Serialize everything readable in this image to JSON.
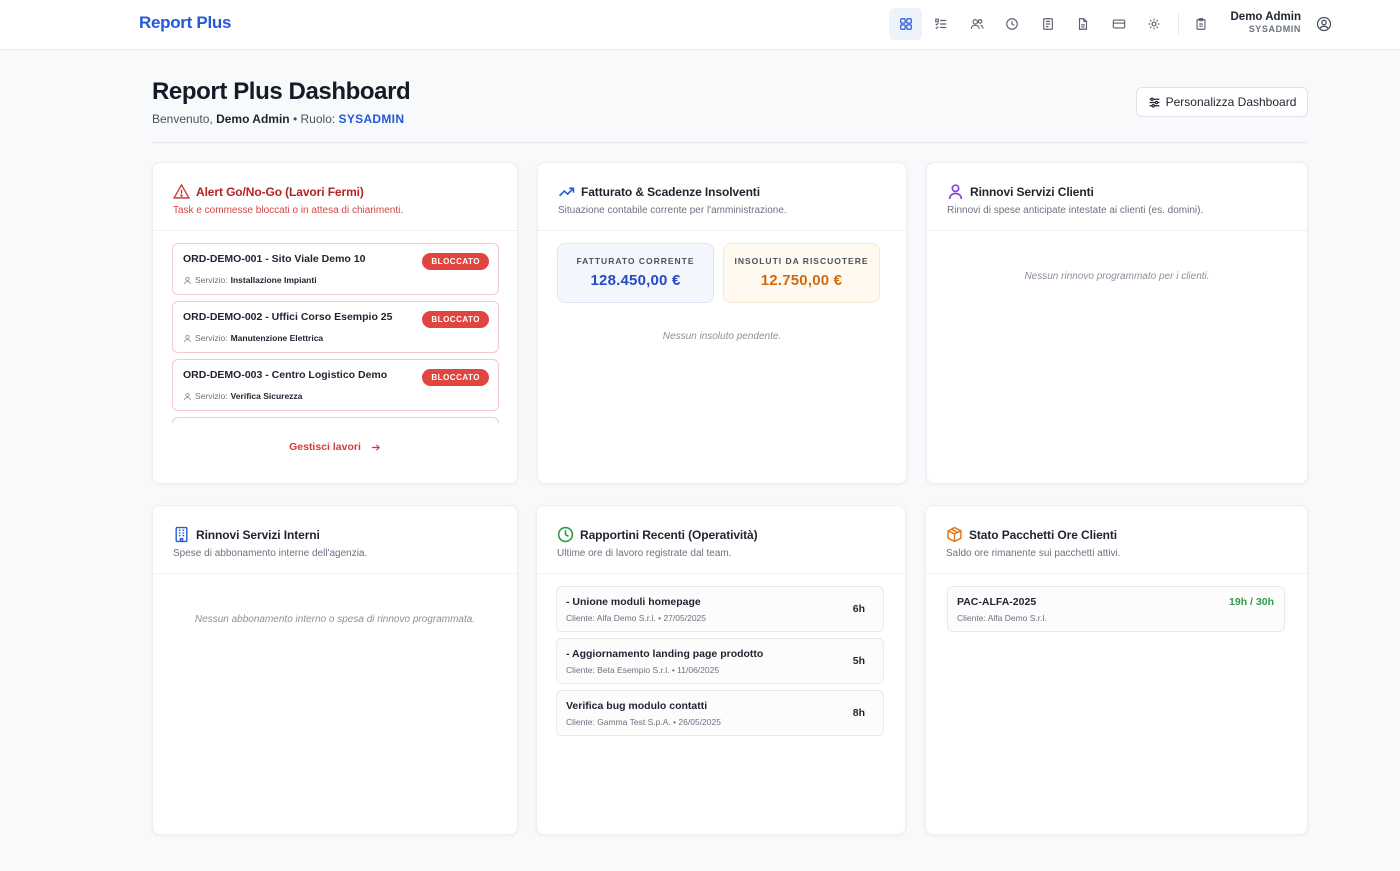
{
  "app": {
    "brand": "Report Plus"
  },
  "nav": {
    "icons": [
      "dashboard-icon",
      "checklist-icon",
      "users-icon",
      "clock-icon",
      "document-icon",
      "file-icon",
      "credit-card-icon",
      "gear-icon",
      "clipboard-icon"
    ],
    "active": "dashboard-icon"
  },
  "user": {
    "name": "Demo Admin",
    "role": "SYSADMIN"
  },
  "header": {
    "title": "Report Plus Dashboard",
    "welcome_prefix": "Benvenuto,",
    "welcome_name": "Demo Admin",
    "separator": "•",
    "role_prefix": "Ruolo:",
    "role": "SYSADMIN",
    "customize_label": "Personalizza Dashboard"
  },
  "alerts": {
    "title": "Alert Go/No-Go (Lavori Fermi)",
    "subtitle": "Task e commesse bloccati o in attesa di chiarimenti.",
    "items": [
      {
        "title": "ORD-DEMO-001 - Sito Viale Demo 10",
        "service_label": "Servizio:",
        "service": "Installazione Impianti",
        "status": "BLOCCATO"
      },
      {
        "title": "ORD-DEMO-002 - Uffici Corso Esempio 25",
        "service_label": "Servizio:",
        "service": "Manutenzione Elettrica",
        "status": "BLOCCATO"
      },
      {
        "title": "ORD-DEMO-003 - Centro Logistico Demo",
        "service_label": "Servizio:",
        "service": "Verifica Sicurezza",
        "status": "BLOCCATO"
      }
    ],
    "link_label": "Gestisci lavori"
  },
  "billing": {
    "title": "Fatturato & Scadenze Insolventi",
    "subtitle": "Situazione contabile corrente per l'amministrazione.",
    "current_label": "FATTURATO CORRENTE",
    "current_value": "128.450,00 €",
    "overdue_label": "INSOLUTI DA RISCUOTERE",
    "overdue_value": "12.750,00 €",
    "empty": "Nessun insoluto pendente."
  },
  "client_renewals": {
    "title": "Rinnovi Servizi Clienti",
    "subtitle": "Rinnovi di spese anticipate intestate ai clienti (es. domini).",
    "empty": "Nessun rinnovo programmato per i clienti."
  },
  "internal_renewals": {
    "title": "Rinnovi Servizi Interni",
    "subtitle": "Spese di abbonamento interne dell'agenzia.",
    "empty": "Nessun abbonamento interno o spesa di rinnovo programmata."
  },
  "reports": {
    "title": "Rapportini Recenti (Operatività)",
    "subtitle": "Ultime ore di lavoro registrate dal team.",
    "items": [
      {
        "title": "- Unione moduli homepage",
        "meta": "Cliente: Alfa Demo S.r.l. • 27/05/2025",
        "hours": "6h"
      },
      {
        "title": "- Aggiornamento landing page prodotto",
        "meta": "Cliente: Beta Esempio S.r.l. • 11/06/2025",
        "hours": "5h"
      },
      {
        "title": "Verifica bug modulo contatti",
        "meta": "Cliente: Gamma Test S.p.A. • 26/05/2025",
        "hours": "8h"
      }
    ]
  },
  "packages": {
    "title": "Stato Pacchetti Ore Clienti",
    "subtitle": "Saldo ore rimanente sui pacchetti attivi.",
    "items": [
      {
        "code": "PAC-ALFA-2025",
        "client": "Cliente: Alfa Demo S.r.l.",
        "hours": "19h / 30h"
      }
    ]
  },
  "colors": {
    "brand": "#2459d8",
    "danger": "#e0453f",
    "success": "#2f9a48",
    "warning": "#cf6a14"
  }
}
